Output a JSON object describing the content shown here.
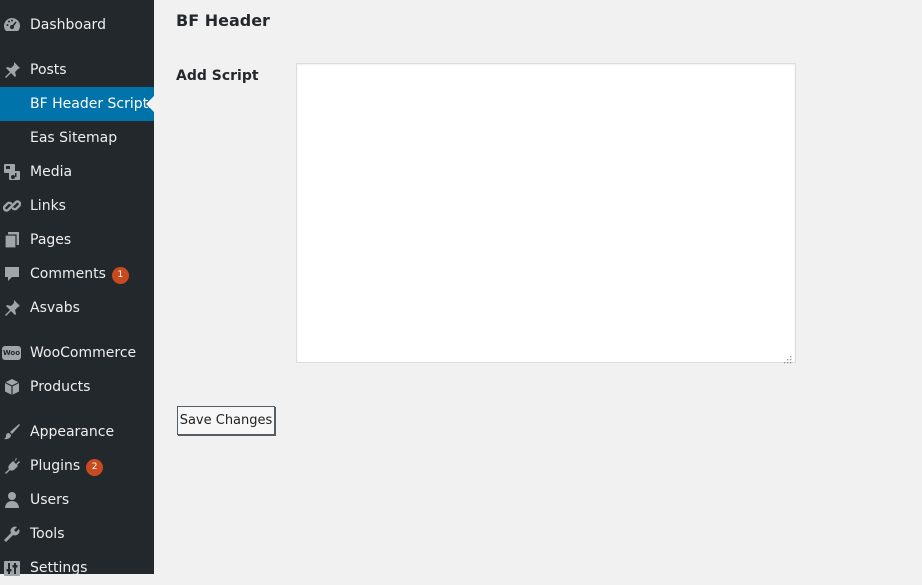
{
  "sidebar": {
    "items": [
      {
        "label": "Dashboard",
        "icon": "dashboard-icon"
      },
      {
        "label": "Posts",
        "icon": "pin-icon"
      },
      {
        "label": "BF Header Scripts",
        "current": true
      },
      {
        "label": "Eas Sitemap"
      },
      {
        "label": "Media",
        "icon": "media-icon"
      },
      {
        "label": "Links",
        "icon": "link-icon"
      },
      {
        "label": "Pages",
        "icon": "pages-icon"
      },
      {
        "label": "Comments",
        "icon": "comment-icon",
        "badge": "1"
      },
      {
        "label": "Asvabs",
        "icon": "pin-icon"
      },
      {
        "label": "WooCommerce",
        "icon": "woo-icon",
        "icon_text": "Woo"
      },
      {
        "label": "Products",
        "icon": "box-icon"
      },
      {
        "label": "Appearance",
        "icon": "brush-icon"
      },
      {
        "label": "Plugins",
        "icon": "plugin-icon",
        "badge": "2"
      },
      {
        "label": "Users",
        "icon": "user-icon"
      },
      {
        "label": "Tools",
        "icon": "wrench-icon"
      },
      {
        "label": "Settings",
        "icon": "settings-icon"
      }
    ]
  },
  "main": {
    "title": "BF Header",
    "field_label": "Add Script",
    "textarea_value": "",
    "save_label": "Save Changes"
  },
  "colors": {
    "sidebar_bg": "#23282d",
    "active_bg": "#0073aa",
    "badge_bg": "#ca4a1f",
    "page_bg": "#f1f1f1"
  }
}
